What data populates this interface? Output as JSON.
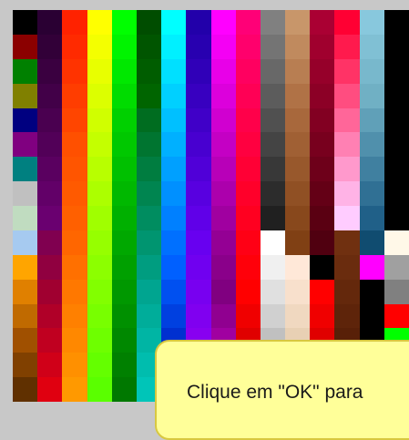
{
  "palette": {
    "columns": [
      [
        "#000000",
        "#8b0000",
        "#008000",
        "#808000",
        "#000080",
        "#800080",
        "#008080",
        "#c0c0c0",
        "#c0dcc0",
        "#a6caf0",
        "#ffa500",
        "#e08000",
        "#c06a00",
        "#a05000",
        "#804000",
        "#603000"
      ],
      [
        "#2a0033",
        "#320038",
        "#3a0040",
        "#420048",
        "#4a0050",
        "#520058",
        "#5a0060",
        "#620068",
        "#6a0070",
        "#800050",
        "#900040",
        "#a00030",
        "#b00028",
        "#c00020",
        "#d00018",
        "#e00010"
      ],
      [
        "#ff2200",
        "#ff2a00",
        "#ff3300",
        "#ff3d00",
        "#ff4500",
        "#ff5000",
        "#ff5500",
        "#ff5a00",
        "#ff6000",
        "#ff6600",
        "#ff7000",
        "#ff7800",
        "#ff8000",
        "#ff8800",
        "#ff9000",
        "#ff9900"
      ],
      [
        "#ffff00",
        "#f4ff00",
        "#e8ff00",
        "#dcff00",
        "#d0ff00",
        "#c4ff00",
        "#b8ff00",
        "#acff00",
        "#a0ff00",
        "#96ff00",
        "#8cff00",
        "#82ff00",
        "#78ff00",
        "#6eff00",
        "#64ff00",
        "#5aff00"
      ],
      [
        "#00ff00",
        "#00f400",
        "#00e800",
        "#00dc00",
        "#00d000",
        "#00c800",
        "#00c000",
        "#00b800",
        "#00b000",
        "#00a800",
        "#00a000",
        "#009800",
        "#009000",
        "#008800",
        "#008000",
        "#007800"
      ],
      [
        "#004d00",
        "#005500",
        "#005d00",
        "#006500",
        "#006d20",
        "#007530",
        "#007d40",
        "#008550",
        "#008d60",
        "#009570",
        "#009d80",
        "#00a590",
        "#00ad9a",
        "#00b5a4",
        "#00bdae",
        "#00c5b8"
      ],
      [
        "#00ffff",
        "#00f0ff",
        "#00e0ff",
        "#00d0ff",
        "#00c0ff",
        "#00b0ff",
        "#00a0ff",
        "#0090ff",
        "#0080ff",
        "#0070ff",
        "#0060ff",
        "#0050f0",
        "#0040e0",
        "#0030d0",
        "#0020c0",
        "#0010b0"
      ],
      [
        "#2200aa",
        "#2800b0",
        "#3000b8",
        "#3800c0",
        "#4000c8",
        "#4800d0",
        "#5000d8",
        "#5800e0",
        "#6000e8",
        "#6800f0",
        "#7000f0",
        "#7800f0",
        "#8000f0",
        "#8800f0",
        "#9000f0",
        "#9800f0"
      ],
      [
        "#ff00ff",
        "#f400f4",
        "#e800e8",
        "#dc00dc",
        "#d000d0",
        "#c400c4",
        "#b800b8",
        "#ac00ac",
        "#a000a0",
        "#940094",
        "#8a008a",
        "#800080",
        "#900090",
        "#a000a0",
        "#b000b0",
        "#c000c0"
      ],
      [
        "#ff0077",
        "#ff006c",
        "#ff0060",
        "#ff0055",
        "#ff004a",
        "#ff0040",
        "#ff0035",
        "#ff002a",
        "#ff0020",
        "#ff0015",
        "#ff000a",
        "#ff0000",
        "#f00000",
        "#e00000",
        "#d00000",
        "#c00000"
      ],
      [
        "#808080",
        "#747474",
        "#686868",
        "#5c5c5c",
        "#505050",
        "#444444",
        "#383838",
        "#2c2c2c",
        "#202020",
        "#ffffff",
        "#f0f0f0",
        "#e0e0e0",
        "#d0d0d0",
        "#c0c0c0",
        "#b0b0b0",
        "#a0a0a0"
      ],
      [
        "#c8966a",
        "#c08a5e",
        "#b87e52",
        "#b07246",
        "#a8683c",
        "#a06034",
        "#98582c",
        "#905024",
        "#88481c",
        "#804014",
        "#ffe8d8",
        "#f8e0cc",
        "#f0d8c0",
        "#e8d0b4",
        "#e0c8a8",
        "#d8c09c"
      ],
      [
        "#aa0033",
        "#a0002e",
        "#96002a",
        "#8c0026",
        "#820022",
        "#78001e",
        "#6e001a",
        "#640016",
        "#5a0012",
        "#500010",
        "#000000",
        "#ff0000",
        "#f00000",
        "#e00000",
        "#d00000",
        "#c00000"
      ],
      [
        "#ff0033",
        "#ff1a4d",
        "#ff3366",
        "#ff4d80",
        "#ff6699",
        "#ff80b3",
        "#ff99cc",
        "#ffb3e6",
        "#ffccff",
        "#703010",
        "#6a2c0e",
        "#64280c",
        "#5e240a",
        "#582008",
        "#0000cc",
        "#0000b0"
      ],
      [
        "#88c8dd",
        "#80c0d4",
        "#78b8cc",
        "#70b0c4",
        "#60a0b8",
        "#5090ac",
        "#4080a0",
        "#307094",
        "#206088",
        "#104c70",
        "#ff00ff",
        "#000000",
        "#000000",
        "#000000",
        "#000000",
        "#000000"
      ],
      [
        "#000000",
        "#000000",
        "#000000",
        "#000000",
        "#000000",
        "#000000",
        "#000000",
        "#000000",
        "#000000",
        "#fff8e8",
        "#a0a0a0",
        "#808080",
        "#ff0000",
        "#00ff00",
        "#ffff00",
        "#0000ff"
      ]
    ]
  },
  "tooltip": {
    "text": "Clique em \"OK\" para"
  }
}
